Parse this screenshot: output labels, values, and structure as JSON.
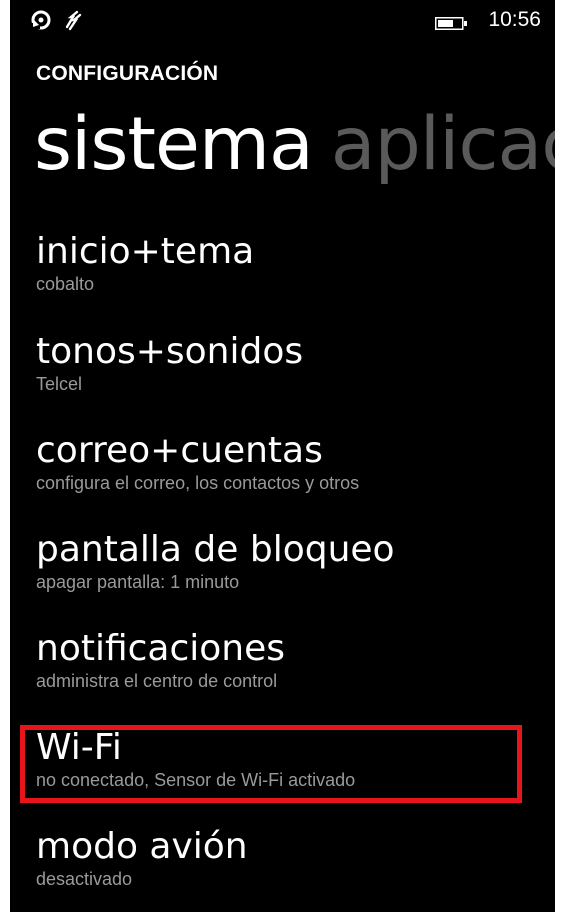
{
  "status_bar": {
    "icons": [
      "sync-icon",
      "data-sense-icon",
      "battery-icon"
    ],
    "time": "10:56"
  },
  "header": {
    "app_title": "CONFIGURACIÓN",
    "pivot_active": "sistema",
    "pivot_next": "aplicac"
  },
  "settings": [
    {
      "title": "inicio+tema",
      "subtitle": "cobalto"
    },
    {
      "title": "tonos+sonidos",
      "subtitle": "Telcel"
    },
    {
      "title": "correo+cuentas",
      "subtitle": "configura el correo, los contactos y otros"
    },
    {
      "title": "pantalla de bloqueo",
      "subtitle": "apagar pantalla: 1 minuto"
    },
    {
      "title": "notificaciones",
      "subtitle": "administra el centro de control"
    },
    {
      "title": "Wi-Fi",
      "subtitle": "no conectado, Sensor de Wi-Fi activado"
    },
    {
      "title": "modo avión",
      "subtitle": "desactivado"
    }
  ],
  "colors": {
    "background": "#000000",
    "text": "#ffffff",
    "subtext": "#9a9a9a",
    "pivot_inactive": "#5a5a5a",
    "highlight": "#e8141c"
  }
}
